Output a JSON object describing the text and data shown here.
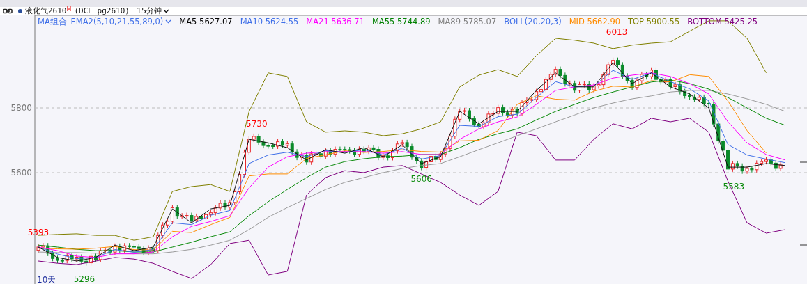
{
  "header": {
    "symbol": "液化气2610",
    "badge": "M",
    "code": "(DCE pg2610)",
    "interval": "15分钟"
  },
  "legend": [
    {
      "label": "MA组合_EMA2(5,10,21,55,89,0)",
      "color": "#3f6fe8",
      "dropdown": true
    },
    {
      "label": "MA5",
      "value": "5627.07",
      "color": "#000000",
      "dropdown": false
    },
    {
      "label": "MA10",
      "value": "5624.55",
      "color": "#3f6fe8",
      "dropdown": false
    },
    {
      "label": "MA21",
      "value": "5636.71",
      "color": "#ff00ff",
      "dropdown": false
    },
    {
      "label": "MA55",
      "value": "5744.89",
      "color": "#008000",
      "dropdown": false
    },
    {
      "label": "MA89",
      "value": "5785.07",
      "color": "#808080",
      "dropdown": false
    },
    {
      "label": "BOLL(20,20,3)",
      "color": "#3f6fe8",
      "dropdown": false
    },
    {
      "label": "MID",
      "value": "5662.90",
      "color": "#ff8c00",
      "dropdown": false
    },
    {
      "label": "TOP",
      "value": "5900.55",
      "color": "#808000",
      "dropdown": false
    },
    {
      "label": "BOTTOM",
      "value": "5425.25",
      "color": "#800080",
      "dropdown": false
    }
  ],
  "chart": {
    "y_axis_labels": [
      "5800",
      "5600"
    ],
    "price_labels": [
      {
        "text": "5393",
        "kind": "high"
      },
      {
        "text": "5296",
        "kind": "low"
      },
      {
        "text": "5730",
        "kind": "high"
      },
      {
        "text": "5606",
        "kind": "low"
      },
      {
        "text": "6013",
        "kind": "high"
      },
      {
        "text": "5583",
        "kind": "low"
      }
    ],
    "period_label": "10天"
  }
}
